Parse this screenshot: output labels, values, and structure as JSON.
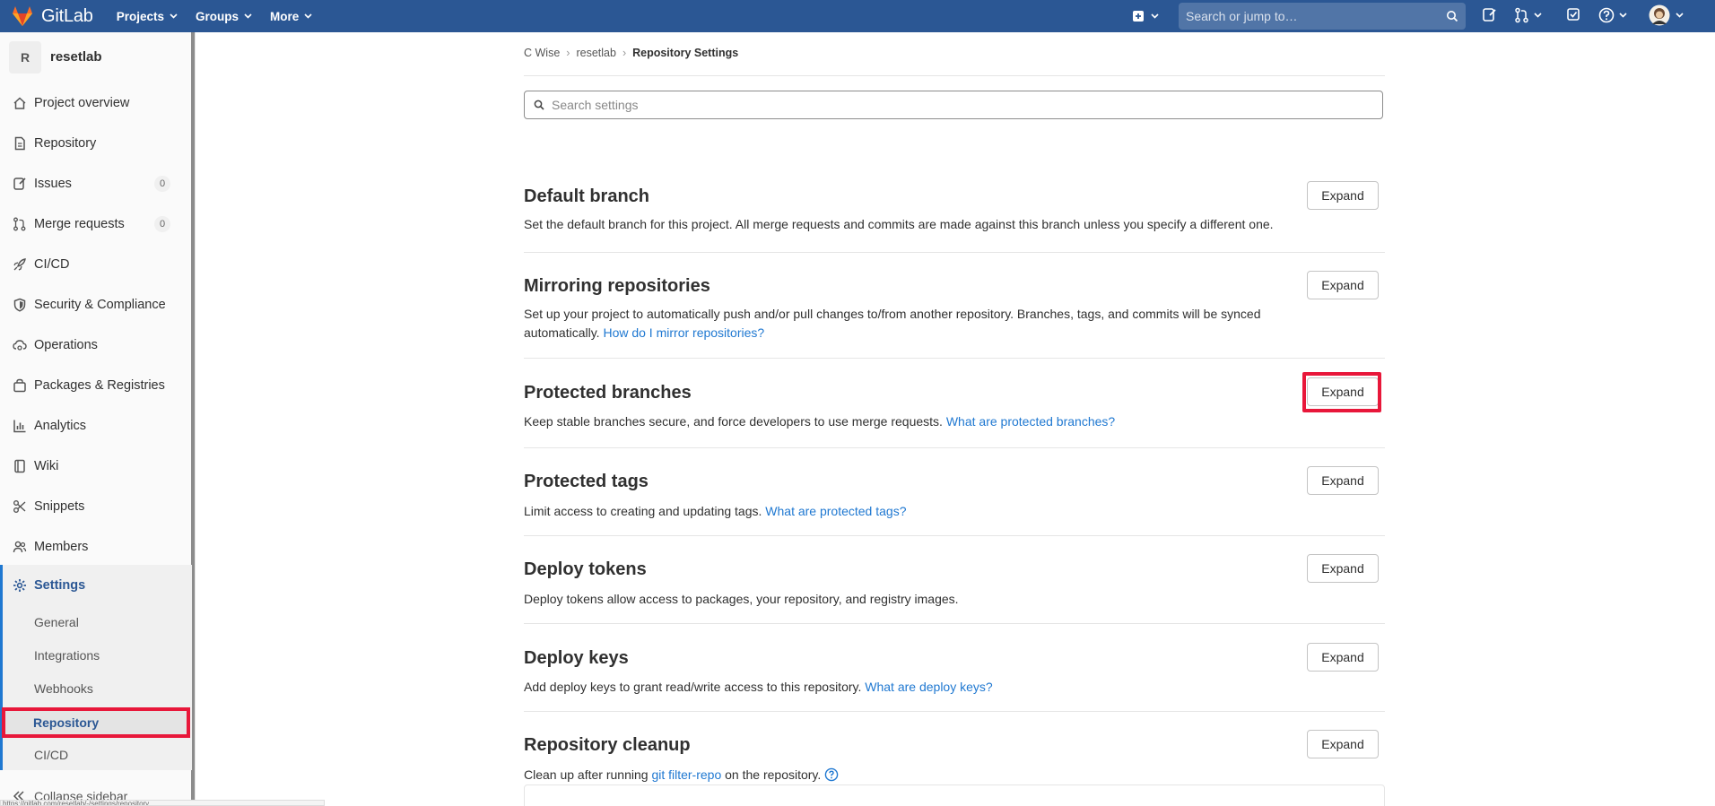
{
  "navbar": {
    "brand": "GitLab",
    "menus": [
      "Projects",
      "Groups",
      "More"
    ],
    "search_placeholder": "Search or jump to…"
  },
  "sidebar": {
    "avatar_letter": "R",
    "project_name": "resetlab",
    "items": [
      {
        "label": "Project overview",
        "icon": "home-icon"
      },
      {
        "label": "Repository",
        "icon": "doc-icon"
      },
      {
        "label": "Issues",
        "icon": "issues-icon",
        "count": "0"
      },
      {
        "label": "Merge requests",
        "icon": "merge-request-icon",
        "count": "0"
      },
      {
        "label": "CI/CD",
        "icon": "rocket-icon"
      },
      {
        "label": "Security & Compliance",
        "icon": "shield-icon"
      },
      {
        "label": "Operations",
        "icon": "cloud-gear-icon"
      },
      {
        "label": "Packages & Registries",
        "icon": "package-icon"
      },
      {
        "label": "Analytics",
        "icon": "chart-icon"
      },
      {
        "label": "Wiki",
        "icon": "book-icon"
      },
      {
        "label": "Snippets",
        "icon": "scissors-icon"
      },
      {
        "label": "Members",
        "icon": "users-icon"
      }
    ],
    "settings_label": "Settings",
    "settings_items": [
      "General",
      "Integrations",
      "Webhooks",
      "Repository",
      "CI/CD"
    ],
    "collapse_label": "Collapse sidebar"
  },
  "breadcrumb": [
    "C Wise",
    "resetlab",
    "Repository Settings"
  ],
  "search_placeholder": "Search settings",
  "sections": [
    {
      "title": "Default branch",
      "desc": "Set the default branch for this project. All merge requests and commits are made against this branch unless you specify a different one.",
      "link": "",
      "button": "Expand"
    },
    {
      "title": "Mirroring repositories",
      "desc": "Set up your project to automatically push and/or pull changes to/from another repository. Branches, tags, and commits will be synced automatically.",
      "link": "How do I mirror repositories?",
      "button": "Expand"
    },
    {
      "title": "Protected branches",
      "desc": "Keep stable branches secure, and force developers to use merge requests.",
      "link": "What are protected branches?",
      "button": "Expand"
    },
    {
      "title": "Protected tags",
      "desc": "Limit access to creating and updating tags.",
      "link": "What are protected tags?",
      "button": "Expand"
    },
    {
      "title": "Deploy tokens",
      "desc": "Deploy tokens allow access to packages, your repository, and registry images.",
      "link": "",
      "button": "Expand"
    },
    {
      "title": "Deploy keys",
      "desc": "Add deploy keys to grant read/write access to this repository.",
      "link": "What are deploy keys?",
      "button": "Expand"
    },
    {
      "title": "Repository cleanup",
      "desc": "Clean up after running",
      "link": "git filter-repo",
      "desc_after": "on the repository.",
      "button": "Expand"
    }
  ],
  "status_url": "https://gitlab.com/resetlab/-/settings/repository",
  "colors": {
    "navbar": "#2b5794",
    "link": "#1f78d1",
    "highlight": "#e8173a"
  }
}
